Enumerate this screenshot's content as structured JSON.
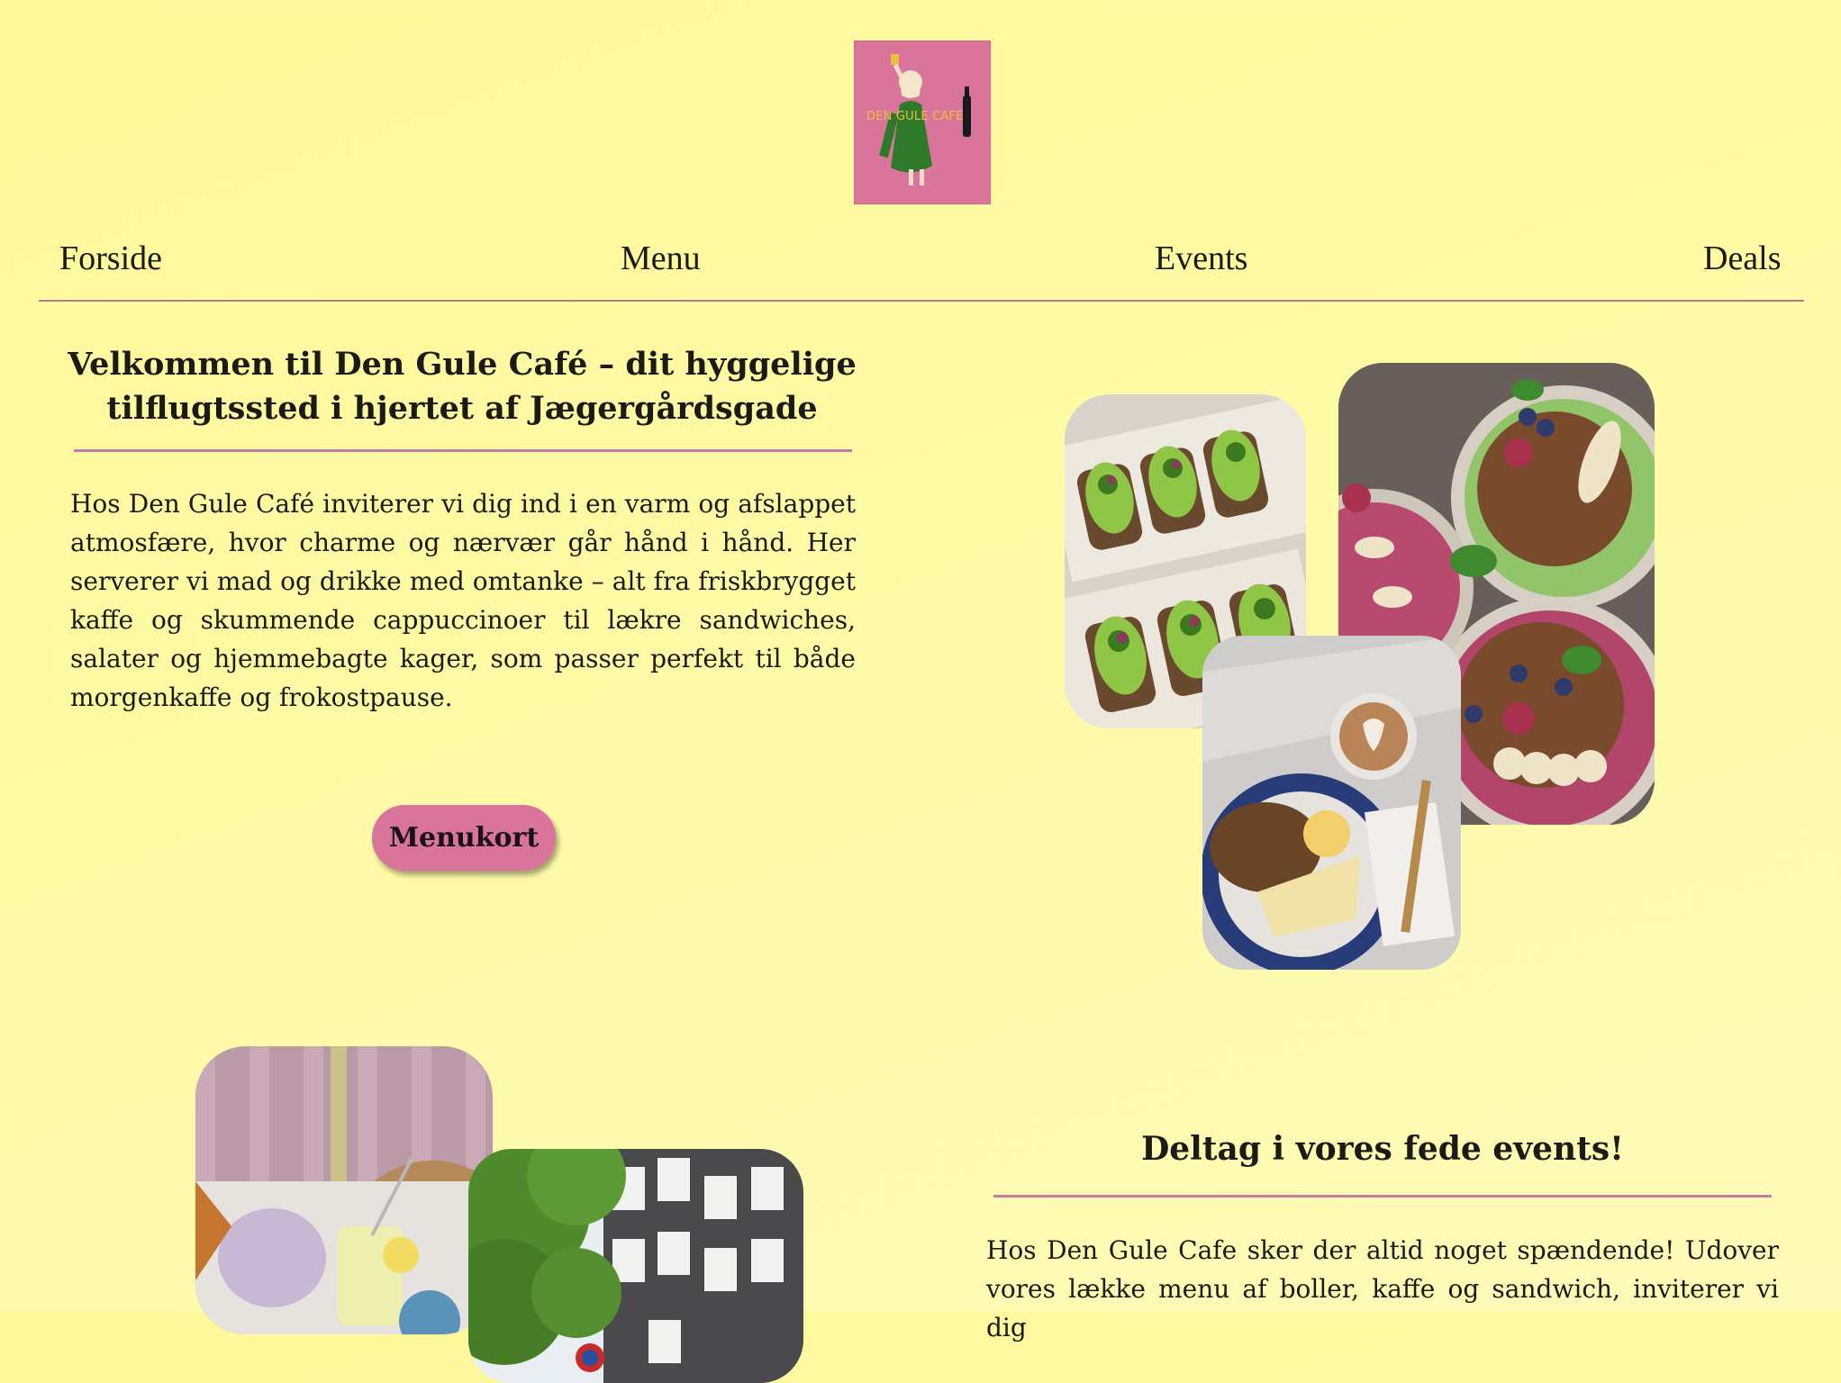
{
  "logo": {
    "text": "DEN GULE CAFE",
    "alt": "Den Gule Café logo",
    "bg_color": "#d9749a"
  },
  "nav": {
    "items": [
      {
        "label": "Forside"
      },
      {
        "label": "Menu"
      },
      {
        "label": "Events"
      },
      {
        "label": "Deals"
      }
    ]
  },
  "welcome": {
    "heading": "Velkommen til Den Gule Café – dit hyggelige tilflugtssted i hjertet af Jægergårdsgade",
    "body": "Hos Den Gule Café inviterer vi dig ind i en varm og afslappet atmosfære, hvor charme og nærvær går hånd i hånd. Her serverer vi mad og drikke med omtanke – alt fra friskbrygget kaffe og skummende cappuccinoer til lækre sandwiches, salater og hjemmebagte kager, som passer perfekt til både morgenkaffe og frokostpause.",
    "button_label": "Menukort"
  },
  "events": {
    "heading": "Deltag i vores fede events!",
    "body": "Hos Den Gule Cafe sker der altid noget spændende! Udover vores lække menu af boller, kaffe og sandwich, inviterer vi dig"
  },
  "images": [
    {
      "name": "avocado-toast-photo"
    },
    {
      "name": "smoothie-bowls-photo"
    },
    {
      "name": "coffee-and-bread-photo"
    },
    {
      "name": "cafe-table-photo"
    },
    {
      "name": "street-photo"
    }
  ],
  "colors": {
    "background": "#fefaa6",
    "accent_pink": "#d9749a",
    "rule": "#c97aa0",
    "nav_line": "#b57a90",
    "text": "#1c1a14"
  }
}
